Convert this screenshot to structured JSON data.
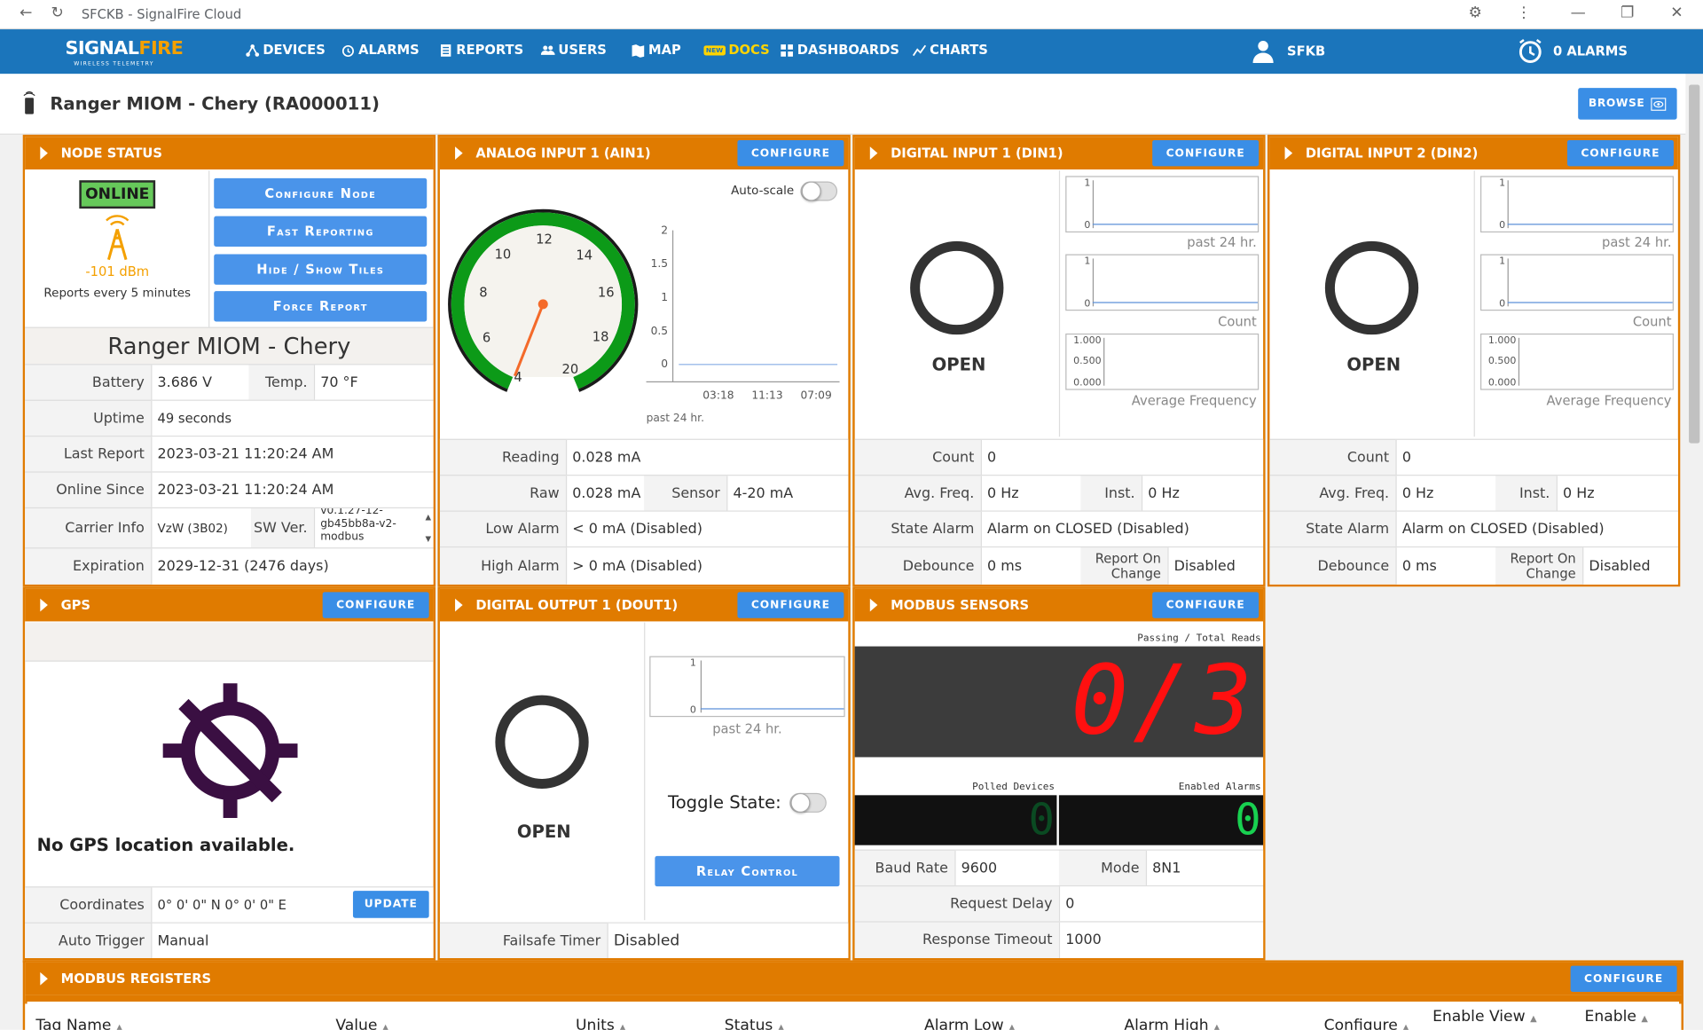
{
  "browser": {
    "title": "SFCKB - SignalFire Cloud"
  },
  "nav": {
    "logo_main": "SIGNAL",
    "logo_accent": "FIRE",
    "logo_sub": "WIRELESS TELEMETRY",
    "devices": "DEVICES",
    "alarms": "ALARMS",
    "reports": "REPORTS",
    "users": "USERS",
    "map": "MAP",
    "docs_new": "NEW",
    "docs": "DOCS",
    "dashboards": "DASHBOARDS",
    "charts": "CHARTS",
    "user": "SFKB",
    "alarm_count": "0 ALARMS"
  },
  "header": {
    "title": "Ranger MIOM - Chery (RA000011)",
    "browse": "BROWSE"
  },
  "common": {
    "configure": "CONFIGURE"
  },
  "node_status": {
    "title": "NODE STATUS",
    "status": "ONLINE",
    "signal": "-101 dBm",
    "reports": "Reports every 5 minutes",
    "btn_configure": "Configure Node",
    "btn_fast": "Fast Reporting",
    "btn_hide": "Hide / Show Tiles",
    "btn_force": "Force Report",
    "name": "Ranger MIOM - Chery",
    "battery_label": "Battery",
    "battery": "3.686 V",
    "temp_label": "Temp.",
    "temp": "70 °F",
    "uptime_label": "Uptime",
    "uptime": "49 seconds",
    "last_report_label": "Last Report",
    "last_report": "2023-03-21 11:20:24 AM",
    "online_since_label": "Online Since",
    "online_since": "2023-03-21 11:20:24 AM",
    "carrier_label": "Carrier Info",
    "carrier": "VzW (3B02)",
    "sw_label": "SW Ver.",
    "sw": "v0.1.27-12-gb45bb8a-v2-modbus",
    "expiration_label": "Expiration",
    "expiration": "2029-12-31 (2476 days)"
  },
  "ain1": {
    "title": "ANALOG INPUT 1 (AIN1)",
    "autoscale": "Auto-scale",
    "gauge_ticks": [
      "4",
      "6",
      "8",
      "10",
      "12",
      "14",
      "16",
      "18",
      "20"
    ],
    "chart_y": [
      "2",
      "1.5",
      "1",
      "0.5",
      "0"
    ],
    "chart_x": [
      "03:18",
      "11:13",
      "07:09"
    ],
    "chart_cap": "past 24 hr.",
    "reading_label": "Reading",
    "reading": "0.028 mA",
    "raw_label": "Raw",
    "raw": "0.028 mA",
    "sensor_label": "Sensor",
    "sensor": "4-20 mA",
    "low_label": "Low Alarm",
    "low": "< 0 mA (Disabled)",
    "high_label": "High Alarm",
    "high": "> 0 mA (Disabled)"
  },
  "din1": {
    "title": "DIGITAL INPUT 1 (DIN1)",
    "state": "OPEN",
    "cap1": "past 24 hr.",
    "cap2": "Count",
    "cap3": "Average Frequency",
    "count_label": "Count",
    "count": "0",
    "avg_label": "Avg. Freq.",
    "avg": "0 Hz",
    "inst_label": "Inst.",
    "inst": "0 Hz",
    "state_alarm_label": "State Alarm",
    "state_alarm": "Alarm on CLOSED (Disabled)",
    "debounce_label": "Debounce",
    "debounce": "0 ms",
    "roc_label": "Report On Change",
    "roc": "Disabled"
  },
  "din2": {
    "title": "DIGITAL INPUT 2 (DIN2)",
    "state": "OPEN",
    "cap1": "past 24 hr.",
    "cap2": "Count",
    "cap3": "Average Frequency",
    "count_label": "Count",
    "count": "0",
    "avg_label": "Avg. Freq.",
    "avg": "0 Hz",
    "inst_label": "Inst.",
    "inst": "0 Hz",
    "state_alarm_label": "State Alarm",
    "state_alarm": "Alarm on CLOSED (Disabled)",
    "debounce_label": "Debounce",
    "debounce": "0 ms",
    "roc_label": "Report On Change",
    "roc": "Disabled"
  },
  "mini_ticks": {
    "one": "1",
    "zero": "0",
    "f1": "1.000",
    "f05": "0.500",
    "f0": "0.000"
  },
  "gps": {
    "title": "GPS",
    "no_location": "No GPS location available.",
    "coord_label": "Coordinates",
    "coords": "0° 0' 0\" N 0° 0' 0\" E",
    "update": "UPDATE",
    "trigger_label": "Auto Trigger",
    "trigger": "Manual"
  },
  "dout1": {
    "title": "DIGITAL OUTPUT 1 (DOUT1)",
    "state": "OPEN",
    "cap": "past 24 hr.",
    "toggle_label": "Toggle State:",
    "relay": "Relay Control",
    "failsafe_label": "Failsafe Timer",
    "failsafe": "Disabled"
  },
  "modbus": {
    "title": "MODBUS SENSORS",
    "passing_label": "Passing / Total Reads",
    "passing": "0/3",
    "polled_label": "Polled Devices",
    "polled": "0",
    "enabled_label": "Enabled Alarms",
    "enabled": "0",
    "baud_label": "Baud Rate",
    "baud": "9600",
    "mode_label": "Mode",
    "mode": "8N1",
    "delay_label": "Request Delay",
    "delay": "0",
    "timeout_label": "Response Timeout",
    "timeout": "1000"
  },
  "registers": {
    "title": "MODBUS REGISTERS",
    "columns": [
      "Tag Name",
      "Value",
      "Units",
      "Status",
      "Alarm Low",
      "Alarm High",
      "Configure",
      "Enable View",
      "Enable"
    ]
  }
}
